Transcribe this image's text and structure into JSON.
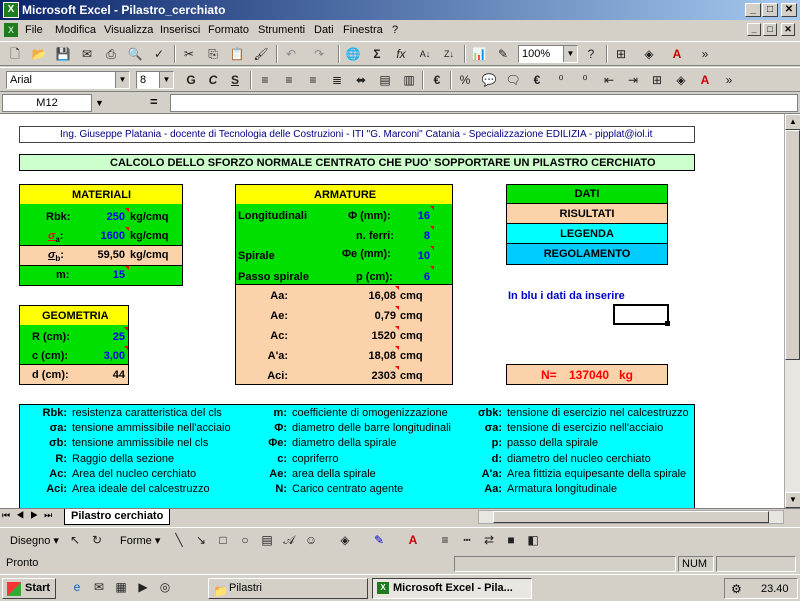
{
  "window": {
    "title": "Microsoft Excel - Pilastro_cerchiato",
    "app_icon": "X"
  },
  "menu": [
    "File",
    "Modifica",
    "Visualizza",
    "Inserisci",
    "Formato",
    "Strumenti",
    "Dati",
    "Finestra",
    "?"
  ],
  "toolbar": {
    "zoom": "100%",
    "font": "Arial",
    "size": "8"
  },
  "formula_bar": {
    "name_box": "M12",
    "equals": "="
  },
  "sheet": {
    "header_line": "Ing. Giuseppe Platania - docente di Tecnologia delle Costruzioni - ITI \"G. Marconi\" Catania - Specializzazione EDILIZIA - pipplat@iol.it",
    "title": "CALCOLO DELLO SFORZO NORMALE CENTRATO CHE PUO' SOPPORTARE UN PILASTRO CERCHIATO",
    "materiali": {
      "head": "MATERIALI",
      "rbk_label": "Rbk:",
      "rbk_value": "250",
      "rbk_unit": "kg/cmq",
      "sa_sym": "σ",
      "sa_sub": "a",
      "sa_value": "1600",
      "sa_unit": "kg/cmq",
      "sb_sym": "σ",
      "sb_sub": "b",
      "sb_value": "59,50",
      "sb_unit": "kg/cmq",
      "m_label": "m:",
      "m_value": "15"
    },
    "geometria": {
      "head": "GEOMETRIA",
      "r_label": "R (cm):",
      "r_value": "25",
      "c_label": "c (cm):",
      "c_value": "3,00",
      "d_label": "d (cm):",
      "d_value": "44"
    },
    "armature": {
      "head": "ARMATURE",
      "long_label": "Longitudinali",
      "phi_label": "Φ (mm):",
      "phi_value": "16",
      "nferri_label": "n. ferri:",
      "nferri_value": "8",
      "spirale_label": "Spirale",
      "phie_label": "Φe (mm):",
      "phie_value": "10",
      "passo_label": "Passo spirale",
      "p_label": "p (cm):",
      "p_value": "6",
      "results": [
        {
          "label": "Aa:",
          "value": "16,08",
          "unit": "cmq"
        },
        {
          "label": "Ae:",
          "value": "0,79",
          "unit": "cmq"
        },
        {
          "label": "Ac:",
          "value": "1520",
          "unit": "cmq"
        },
        {
          "label": "A'a:",
          "value": "18,08",
          "unit": "cmq"
        },
        {
          "label": "Aci:",
          "value": "2303",
          "unit": "cmq"
        }
      ]
    },
    "legend_box": [
      "DATI",
      "RISULTATI",
      "LEGENDA",
      "REGOLAMENTO"
    ],
    "hint": "In blu i dati da inserire",
    "result": {
      "label": "N=",
      "value": "137040",
      "unit": "kg"
    },
    "legend": {
      "rows": [
        [
          {
            "k": "Rbk:",
            "v": "resistenza caratteristica del cls"
          },
          {
            "k": "m:",
            "v": "coefficiente di omogenizzazione"
          },
          {
            "k": "σbk:",
            "v": "tensione di esercizio nel calcestruzzo"
          }
        ],
        [
          {
            "k": "σa:",
            "v": "tensione ammissibile nell'acciaio"
          },
          {
            "k": "Φ:",
            "v": "diametro delle barre longitudinali"
          },
          {
            "k": "σa:",
            "v": "tensione di esercizio nell'acciaio"
          }
        ],
        [
          {
            "k": "σb:",
            "v": "tensione ammissibile nel cls"
          },
          {
            "k": "Φe:",
            "v": "diametro della spirale"
          },
          {
            "k": "p:",
            "v": "passo della spirale"
          }
        ],
        [
          {
            "k": "R:",
            "v": "Raggio della sezione"
          },
          {
            "k": "c:",
            "v": "copriferro"
          },
          {
            "k": "d:",
            "v": "diametro del nucleo cerchiato"
          }
        ],
        [
          {
            "k": "Ac:",
            "v": "Area del nucleo cerchiato"
          },
          {
            "k": "Ae:",
            "v": "area della spirale"
          },
          {
            "k": "A'a:",
            "v": "Area fittizia equipesante della spirale"
          }
        ],
        [
          {
            "k": "Aci:",
            "v": "Area ideale del calcestruzzo"
          },
          {
            "k": "N:",
            "v": "Carico centrato agente"
          },
          {
            "k": "Aa:",
            "v": "Armatura longitudinale"
          }
        ]
      ]
    }
  },
  "sheet_tab": "Pilastro cerchiato",
  "drawing": {
    "disegno": "Disegno",
    "forme": "Forme"
  },
  "status": {
    "left": "Pronto",
    "num": "NUM"
  },
  "taskbar": {
    "start": "Start",
    "tasks": [
      "Pilastri",
      "Microsoft Excel - Pila..."
    ],
    "clock": "23.40"
  }
}
